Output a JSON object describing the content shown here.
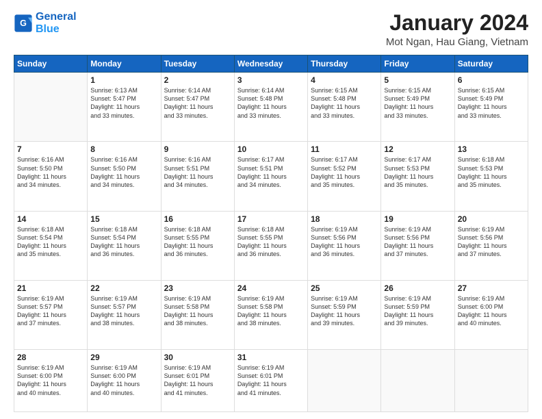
{
  "logo": {
    "line1": "General",
    "line2": "Blue"
  },
  "header": {
    "title": "January 2024",
    "location": "Mot Ngan, Hau Giang, Vietnam"
  },
  "weekdays": [
    "Sunday",
    "Monday",
    "Tuesday",
    "Wednesday",
    "Thursday",
    "Friday",
    "Saturday"
  ],
  "weeks": [
    [
      {
        "day": "",
        "info": ""
      },
      {
        "day": "1",
        "info": "Sunrise: 6:13 AM\nSunset: 5:47 PM\nDaylight: 11 hours\nand 33 minutes."
      },
      {
        "day": "2",
        "info": "Sunrise: 6:14 AM\nSunset: 5:47 PM\nDaylight: 11 hours\nand 33 minutes."
      },
      {
        "day": "3",
        "info": "Sunrise: 6:14 AM\nSunset: 5:48 PM\nDaylight: 11 hours\nand 33 minutes."
      },
      {
        "day": "4",
        "info": "Sunrise: 6:15 AM\nSunset: 5:48 PM\nDaylight: 11 hours\nand 33 minutes."
      },
      {
        "day": "5",
        "info": "Sunrise: 6:15 AM\nSunset: 5:49 PM\nDaylight: 11 hours\nand 33 minutes."
      },
      {
        "day": "6",
        "info": "Sunrise: 6:15 AM\nSunset: 5:49 PM\nDaylight: 11 hours\nand 33 minutes."
      }
    ],
    [
      {
        "day": "7",
        "info": "Sunrise: 6:16 AM\nSunset: 5:50 PM\nDaylight: 11 hours\nand 34 minutes."
      },
      {
        "day": "8",
        "info": "Sunrise: 6:16 AM\nSunset: 5:50 PM\nDaylight: 11 hours\nand 34 minutes."
      },
      {
        "day": "9",
        "info": "Sunrise: 6:16 AM\nSunset: 5:51 PM\nDaylight: 11 hours\nand 34 minutes."
      },
      {
        "day": "10",
        "info": "Sunrise: 6:17 AM\nSunset: 5:51 PM\nDaylight: 11 hours\nand 34 minutes."
      },
      {
        "day": "11",
        "info": "Sunrise: 6:17 AM\nSunset: 5:52 PM\nDaylight: 11 hours\nand 35 minutes."
      },
      {
        "day": "12",
        "info": "Sunrise: 6:17 AM\nSunset: 5:53 PM\nDaylight: 11 hours\nand 35 minutes."
      },
      {
        "day": "13",
        "info": "Sunrise: 6:18 AM\nSunset: 5:53 PM\nDaylight: 11 hours\nand 35 minutes."
      }
    ],
    [
      {
        "day": "14",
        "info": "Sunrise: 6:18 AM\nSunset: 5:54 PM\nDaylight: 11 hours\nand 35 minutes."
      },
      {
        "day": "15",
        "info": "Sunrise: 6:18 AM\nSunset: 5:54 PM\nDaylight: 11 hours\nand 36 minutes."
      },
      {
        "day": "16",
        "info": "Sunrise: 6:18 AM\nSunset: 5:55 PM\nDaylight: 11 hours\nand 36 minutes."
      },
      {
        "day": "17",
        "info": "Sunrise: 6:18 AM\nSunset: 5:55 PM\nDaylight: 11 hours\nand 36 minutes."
      },
      {
        "day": "18",
        "info": "Sunrise: 6:19 AM\nSunset: 5:56 PM\nDaylight: 11 hours\nand 36 minutes."
      },
      {
        "day": "19",
        "info": "Sunrise: 6:19 AM\nSunset: 5:56 PM\nDaylight: 11 hours\nand 37 minutes."
      },
      {
        "day": "20",
        "info": "Sunrise: 6:19 AM\nSunset: 5:56 PM\nDaylight: 11 hours\nand 37 minutes."
      }
    ],
    [
      {
        "day": "21",
        "info": "Sunrise: 6:19 AM\nSunset: 5:57 PM\nDaylight: 11 hours\nand 37 minutes."
      },
      {
        "day": "22",
        "info": "Sunrise: 6:19 AM\nSunset: 5:57 PM\nDaylight: 11 hours\nand 38 minutes."
      },
      {
        "day": "23",
        "info": "Sunrise: 6:19 AM\nSunset: 5:58 PM\nDaylight: 11 hours\nand 38 minutes."
      },
      {
        "day": "24",
        "info": "Sunrise: 6:19 AM\nSunset: 5:58 PM\nDaylight: 11 hours\nand 38 minutes."
      },
      {
        "day": "25",
        "info": "Sunrise: 6:19 AM\nSunset: 5:59 PM\nDaylight: 11 hours\nand 39 minutes."
      },
      {
        "day": "26",
        "info": "Sunrise: 6:19 AM\nSunset: 5:59 PM\nDaylight: 11 hours\nand 39 minutes."
      },
      {
        "day": "27",
        "info": "Sunrise: 6:19 AM\nSunset: 6:00 PM\nDaylight: 11 hours\nand 40 minutes."
      }
    ],
    [
      {
        "day": "28",
        "info": "Sunrise: 6:19 AM\nSunset: 6:00 PM\nDaylight: 11 hours\nand 40 minutes."
      },
      {
        "day": "29",
        "info": "Sunrise: 6:19 AM\nSunset: 6:00 PM\nDaylight: 11 hours\nand 40 minutes."
      },
      {
        "day": "30",
        "info": "Sunrise: 6:19 AM\nSunset: 6:01 PM\nDaylight: 11 hours\nand 41 minutes."
      },
      {
        "day": "31",
        "info": "Sunrise: 6:19 AM\nSunset: 6:01 PM\nDaylight: 11 hours\nand 41 minutes."
      },
      {
        "day": "",
        "info": ""
      },
      {
        "day": "",
        "info": ""
      },
      {
        "day": "",
        "info": ""
      }
    ]
  ]
}
